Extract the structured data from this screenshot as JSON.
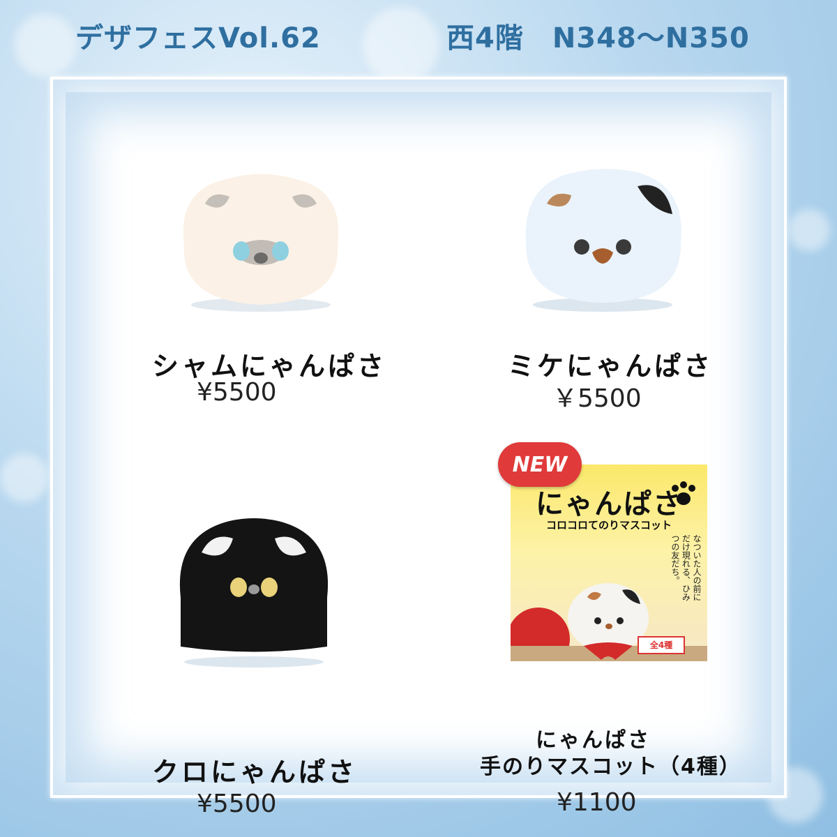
{
  "header": {
    "event": "デザフェスVol.62",
    "booth": "西4階　N348〜N350"
  },
  "products": [
    {
      "name": "シャムにゃんぱさ",
      "price": "¥5500",
      "image_icon": "siamese-cat-plush-icon"
    },
    {
      "name": "ミケにゃんぱさ",
      "price": "￥5500",
      "image_icon": "calico-cat-plush-icon"
    },
    {
      "name": "クロにゃんぱさ",
      "price": "¥5500",
      "image_icon": "black-cat-plush-icon"
    },
    {
      "name_line1": "にゃんぱさ",
      "name_line2": "手のりマスコット（4種）",
      "price": "¥1100",
      "image_icon": "package-card-icon"
    }
  ],
  "new_card": {
    "badge": "NEW",
    "title": "にゃんぱさ",
    "subtitle": "コロコロてのりマスコット",
    "tagline": "なついた人の前にだけ現れる、ひみつの友だち。",
    "count": "全4種"
  },
  "colors": {
    "header_text": "#2f6fa0",
    "badge_red": "#e03a3a",
    "card_yellow": "#fbe86a"
  }
}
